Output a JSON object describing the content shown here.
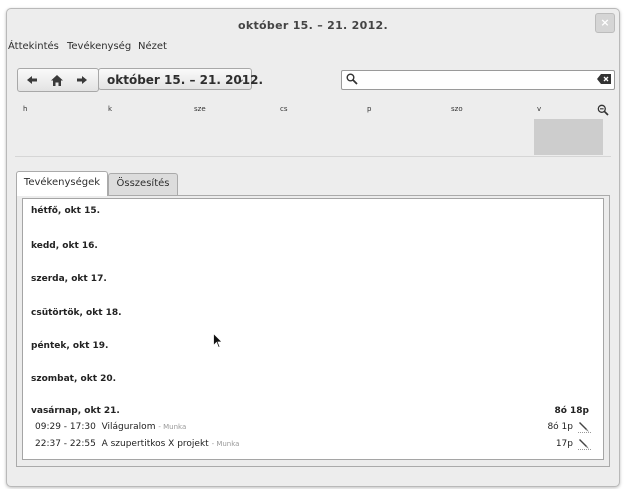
{
  "window": {
    "title": "október 15. – 21. 2012.",
    "close_glyph": "×"
  },
  "menu": [
    {
      "label": "Áttekintés"
    },
    {
      "label": "Tevékenység"
    },
    {
      "label": "Nézet"
    }
  ],
  "toolbar": {
    "range_label": "október 15. – 21. 2012.",
    "range_chevron": "⌄",
    "search_value": "",
    "search_placeholder": "",
    "icons": [
      "arrow-left-icon",
      "home-icon",
      "arrow-right-icon",
      "search-icon",
      "clear-icon"
    ]
  },
  "day_headers": [
    "h",
    "k",
    "sze",
    "cs",
    "p",
    "szo",
    "v"
  ],
  "tabs": [
    {
      "label": "Tevékenységek",
      "active": true
    },
    {
      "label": "Összesítés",
      "active": false
    }
  ],
  "days": [
    {
      "label": "hétfő, okt 15.",
      "total": "",
      "facts": []
    },
    {
      "label": "kedd, okt 16.",
      "total": "",
      "facts": []
    },
    {
      "label": "szerda, okt 17.",
      "total": "",
      "facts": []
    },
    {
      "label": "csütörtök, okt 18.",
      "total": "",
      "facts": []
    },
    {
      "label": "péntek, okt 19.",
      "total": "",
      "facts": []
    },
    {
      "label": "szombat, okt 20.",
      "total": "",
      "facts": []
    },
    {
      "label": "vasárnap, okt 21.",
      "total": "8ó 18p",
      "facts": [
        {
          "time": "09:29 - 17:30",
          "activity": "Világuralom",
          "category": " - Munka",
          "duration": "8ó 1p"
        },
        {
          "time": "22:37 - 22:55",
          "activity": "A szupertitkos X projekt",
          "category": " - Munka",
          "duration": "17p"
        }
      ]
    }
  ],
  "colors": {
    "window_bg": "#ededed",
    "list_bg": "#ffffff",
    "chart_block": "#cdcdcd",
    "category_text": "#999999"
  }
}
